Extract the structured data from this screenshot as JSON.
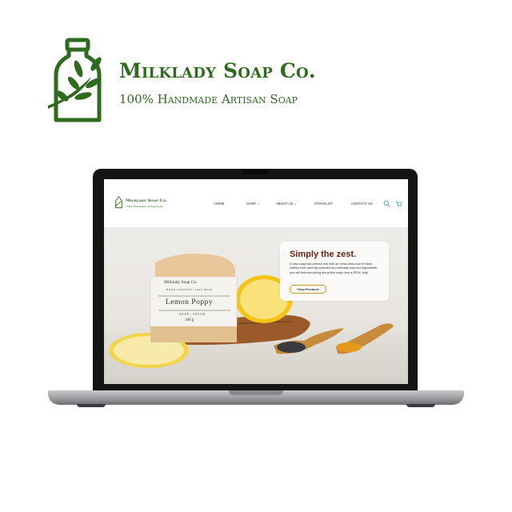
{
  "brand": {
    "name": "Milklady Soap Co.",
    "tagline": "100% Handmade Artisan Soap",
    "color": "#2e6b1f",
    "logo_icon": "bottle-leaf-icon"
  },
  "site": {
    "logo_name": "Milklady Soap Co.",
    "logo_tagline": "100% Handmade Artisan Soap",
    "nav": {
      "home": "HOME",
      "shop": "SHOP",
      "about": "ABOUT US",
      "stockist": "STOCKLIST",
      "contact": "CONTACT US"
    },
    "icons": {
      "search": "search-icon",
      "cart": "cart-icon"
    },
    "accent": "#4aa79b"
  },
  "hero": {
    "title": "Simply the zest.",
    "body": "A new soap has arrived and with an extra zesty scent! Hand crafted with carefully selected and ethically-sourced ingredients, you will find everything about this soap very a-PEEL-ling!",
    "button": "Shop Products",
    "title_color": "#6b2410",
    "button_border": "#c49a1c"
  },
  "product_label": {
    "brand": "Milklady Soap Co.",
    "subtitle": "HAND CRAFTED | SALT MAIN",
    "name": "Lemon Poppy",
    "type": "SOAP | SAVON",
    "weight": "100 g"
  }
}
